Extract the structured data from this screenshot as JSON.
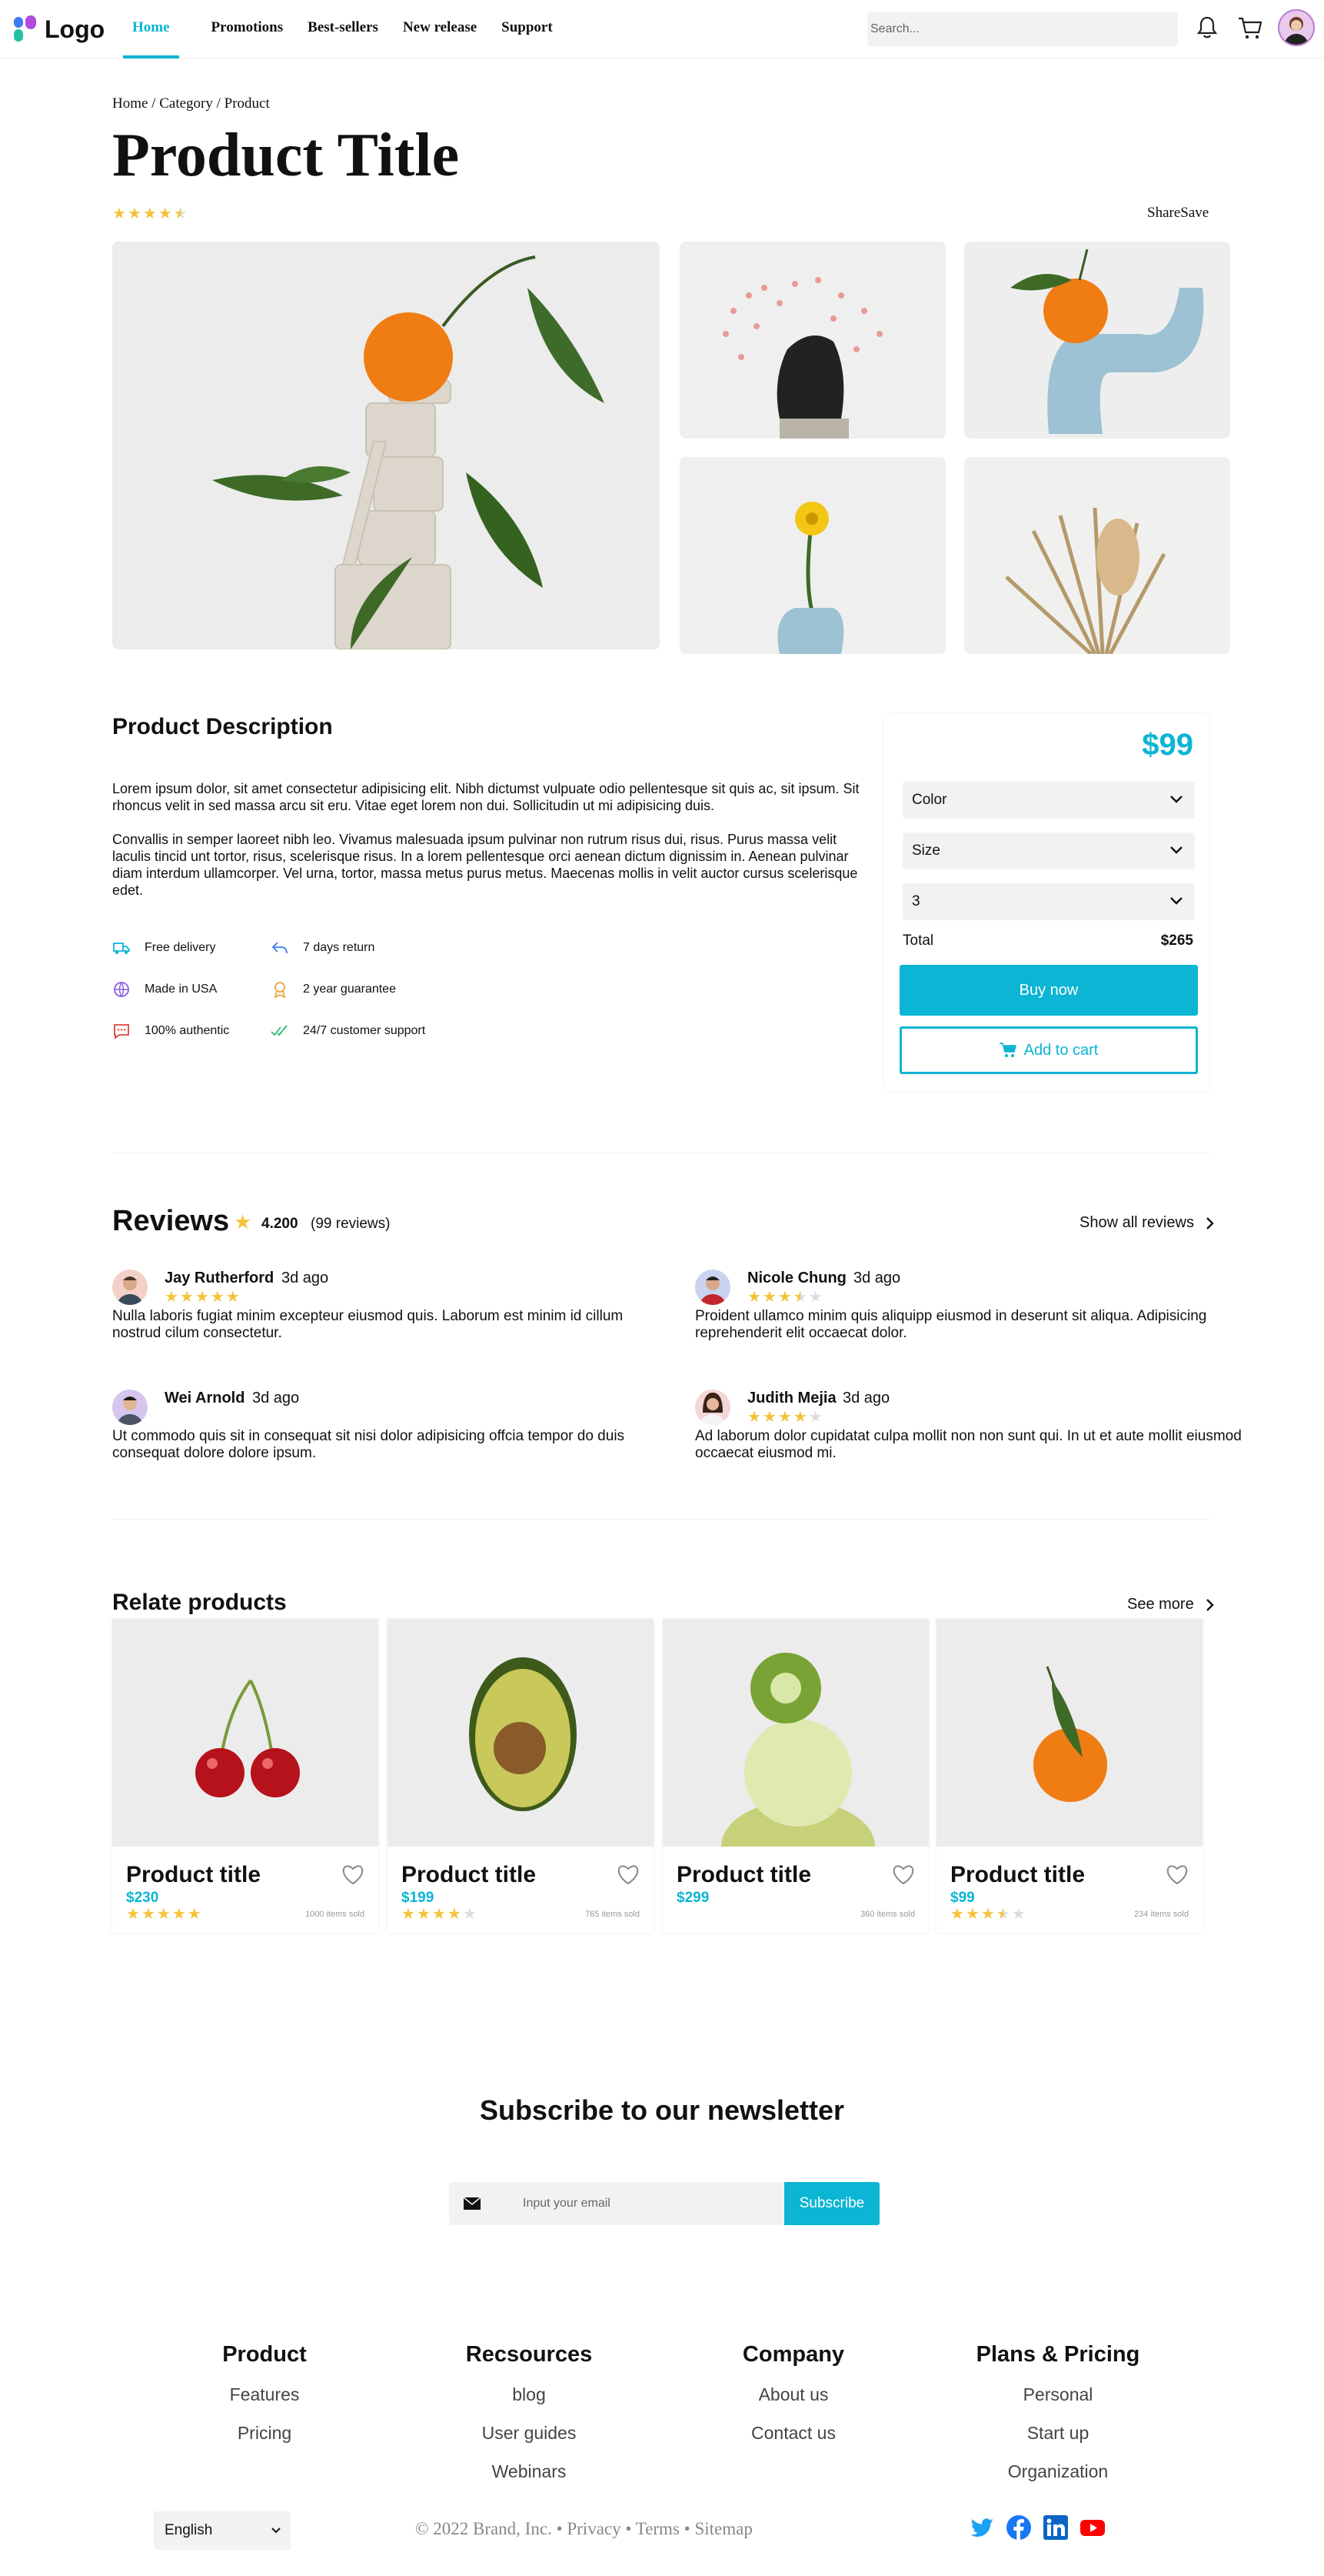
{
  "header": {
    "logo_text": "Logo",
    "nav": [
      "Home",
      "Promotions",
      "Best-sellers",
      "New release",
      "Support"
    ],
    "active_nav": "Home",
    "search_placeholder": "Search..."
  },
  "product": {
    "breadcrumb": "Home / Category / Product",
    "title": "Product Title",
    "rating": 4.5,
    "share_save": "ShareSave",
    "description_heading": "Product Description",
    "description_p1": "Lorem ipsum dolor, sit amet consectetur adipisicing elit. Nibh dictumst vulpuate odio pellentesque sit quis ac, sit ipsum. Sit rhoncus velit in sed massa arcu sit eru. Vitae eget lorem non dui. Sollicitudin ut mi adipisicing duis.",
    "description_p2": "Convallis in semper laoreet nibh leo. Vivamus malesuada ipsum pulvinar non rutrum risus dui, risus. Purus massa velit laculis tincid unt tortor, risus, scelerisque risus. In a lorem pellentesque orci aenean dictum dignissim in. Aenean pulvinar diam interdum ullamcorper. Vel urna, tortor, massa metus purus metus. Maecenas mollis in velit auctor cursus scelerisque edet.",
    "features": [
      {
        "label": "Free delivery",
        "icon": "truck-icon"
      },
      {
        "label": "7 days return",
        "icon": "return-arrow-icon"
      },
      {
        "label": "Made in USA",
        "icon": "globe-icon"
      },
      {
        "label": "2 year guarantee",
        "icon": "medal-icon"
      },
      {
        "label": "100% authentic",
        "icon": "chat-dots-icon"
      },
      {
        "label": "24/7 customer support",
        "icon": "double-check-icon"
      }
    ]
  },
  "purchase": {
    "price": "$99",
    "color_label": "Color",
    "size_label": "Size",
    "quantity": "3",
    "total_label": "Total",
    "total_value": "$265",
    "buy_label": "Buy now",
    "cart_label": "Add to cart"
  },
  "reviews": {
    "heading": "Reviews",
    "score": "4.200",
    "count": "(99 reviews)",
    "show_all": "Show all reviews",
    "items": [
      {
        "name": "Jay Rutherford",
        "date": "3d ago",
        "rating": 5,
        "text": "Nulla laboris fugiat minim excepteur eiusmod quis. Laborum est minim id cillum nostrud cilum consectetur."
      },
      {
        "name": "Nicole Chung",
        "date": "3d ago",
        "rating": 3.5,
        "text": "Proident ullamco minim quis aliquipp eiusmod in deserunt sit aliqua. Adipisicing reprehenderit elit occaecat dolor."
      },
      {
        "name": "Wei Arnold",
        "date": "3d ago",
        "rating": 0,
        "text": "Ut commodo quis sit in consequat sit nisi dolor adipisicing offcia tempor do duis consequat dolore dolore ipsum."
      },
      {
        "name": "Judith Mejia",
        "date": "3d ago",
        "rating": 4,
        "text": "Ad laborum dolor cupidatat culpa mollit non non sunt qui. In ut et aute mollit eiusmod occaecat eiusmod mi."
      }
    ]
  },
  "related": {
    "heading": "Relate products",
    "see_more": "See more",
    "items": [
      {
        "title": "Product title",
        "price": "$230",
        "rating": 5,
        "sold": "1000 items sold",
        "image": "cherries"
      },
      {
        "title": "Product title",
        "price": "$199",
        "rating": 4,
        "sold": "765 items sold",
        "image": "avocado"
      },
      {
        "title": "Product title",
        "price": "$299",
        "rating": 0,
        "sold": "360 items sold",
        "image": "kiwi-lime"
      },
      {
        "title": "Product title",
        "price": "$99",
        "rating": 3.5,
        "sold": "234 items sold",
        "image": "tangerine"
      }
    ]
  },
  "newsletter": {
    "heading": "Subscribe to our newsletter",
    "placeholder": "Input your email",
    "button": "Subscribe"
  },
  "footer": {
    "columns": [
      {
        "heading": "Product",
        "links": [
          "Features",
          "Pricing"
        ]
      },
      {
        "heading": "Recsources",
        "links": [
          "blog",
          "User guides",
          "Webinars"
        ]
      },
      {
        "heading": "Company",
        "links": [
          "About us",
          "Contact us"
        ]
      },
      {
        "heading": "Plans & Pricing",
        "links": [
          "Personal",
          "Start up",
          "Organization"
        ]
      }
    ],
    "language": "English",
    "copyright": "© 2022 Brand, Inc. • Privacy • Terms • Sitemap",
    "social": [
      "twitter-icon",
      "facebook-icon",
      "linkedin-icon",
      "youtube-icon"
    ]
  },
  "colors": {
    "accent": "#0bb5d3",
    "star": "#f5c33b"
  }
}
